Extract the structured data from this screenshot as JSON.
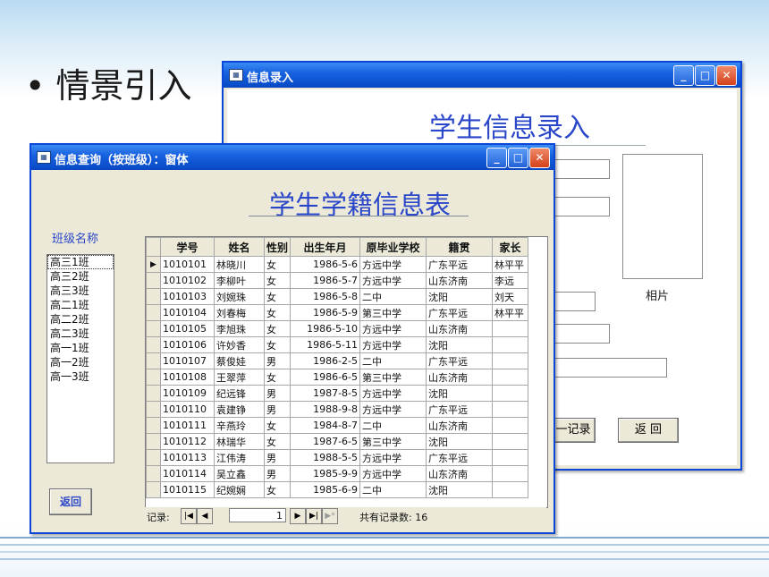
{
  "slide": {
    "bullet": "•",
    "heading": "情景引入"
  },
  "back_window": {
    "title": "信息录入",
    "heading": "学生信息录入",
    "photo_label": "相片",
    "record_button": "一记录",
    "return_button": "返 回"
  },
  "front_window": {
    "title": "信息查询（按班级）：窗体",
    "heading": "学生学籍信息表",
    "class_label": "班级名称",
    "classes": [
      "高三1班",
      "高三2班",
      "高三3班",
      "高二1班",
      "高二2班",
      "高二3班",
      "高一1班",
      "高一2班",
      "高一3班"
    ],
    "return_button": "返回",
    "columns": [
      "学号",
      "姓名",
      "性别",
      "出生年月",
      "原毕业学校",
      "籍贯",
      "家长"
    ],
    "rows": [
      [
        "1010101",
        "林晓川",
        "女",
        "1986-5-6",
        "方远中学",
        "广东平远",
        "林平平"
      ],
      [
        "1010102",
        "李柳叶",
        "女",
        "1986-5-7",
        "方远中学",
        "山东济南",
        "李远"
      ],
      [
        "1010103",
        "刘婉珠",
        "女",
        "1986-5-8",
        "二中",
        "沈阳",
        "刘天"
      ],
      [
        "1010104",
        "刘春梅",
        "女",
        "1986-5-9",
        "第三中学",
        "广东平远",
        "林平平"
      ],
      [
        "1010105",
        "李旭珠",
        "女",
        "1986-5-10",
        "方远中学",
        "山东济南",
        ""
      ],
      [
        "1010106",
        "许妙香",
        "女",
        "1986-5-11",
        "方远中学",
        "沈阳",
        ""
      ],
      [
        "1010107",
        "蔡俊娃",
        "男",
        "1986-2-5",
        "二中",
        "广东平远",
        ""
      ],
      [
        "1010108",
        "王翠萍",
        "女",
        "1986-6-5",
        "第三中学",
        "山东济南",
        ""
      ],
      [
        "1010109",
        "纪远锋",
        "男",
        "1987-8-5",
        "方远中学",
        "沈阳",
        ""
      ],
      [
        "1010110",
        "袁建铮",
        "男",
        "1988-9-8",
        "方远中学",
        "广东平远",
        ""
      ],
      [
        "1010111",
        "辛燕玲",
        "女",
        "1984-8-7",
        "二中",
        "山东济南",
        ""
      ],
      [
        "1010112",
        "林瑞华",
        "女",
        "1987-6-5",
        "第三中学",
        "沈阳",
        ""
      ],
      [
        "1010113",
        "江伟涛",
        "男",
        "1988-5-5",
        "方远中学",
        "广东平远",
        ""
      ],
      [
        "1010114",
        "吴立鑫",
        "男",
        "1985-9-9",
        "方远中学",
        "山东济南",
        ""
      ],
      [
        "1010115",
        "纪婉娴",
        "女",
        "1985-6-9",
        "二中",
        "沈阳",
        ""
      ]
    ],
    "nav": {
      "label": "记录:",
      "current": "1",
      "total": "共有记录数: 16",
      "icons": [
        "first-record-icon",
        "prev-record-icon",
        "next-record-icon",
        "last-record-icon",
        "new-record-icon"
      ]
    }
  },
  "colors": {
    "title_blue": "#0b4fcc",
    "heading_blue": "#2b47c9",
    "window_face": "#ece9d8"
  }
}
